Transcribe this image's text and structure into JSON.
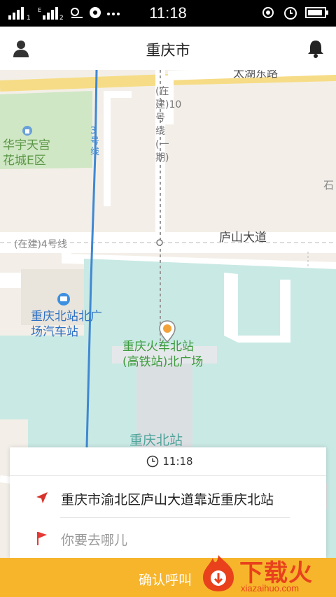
{
  "status_bar": {
    "time": "11:18"
  },
  "header": {
    "title": "重庆市"
  },
  "map": {
    "labels": {
      "road_taihu": "太湖东路",
      "line3": "3号线",
      "line10": "(在建)10号线(一期)",
      "huayu": "华宇天宫花城E区",
      "lushan": "庐山大道",
      "line4": "(在建)4号线",
      "bus_station": "重庆北站北广场汽车站",
      "train_station": "重庆火车北站(高铁站)北广场",
      "north_station": "重庆北站",
      "partial_right": "石"
    }
  },
  "card": {
    "time": "11:18",
    "from_address": "重庆市渝北区庐山大道靠近重庆北站",
    "to_placeholder": "你要去哪儿"
  },
  "bottom": {
    "confirm_label": "确认呼叫"
  },
  "watermark": {
    "brand": "下载火",
    "domain": "xiazaihuo.com"
  },
  "colors": {
    "accent": "#f7b52c",
    "flag": "#e53935",
    "line": "#3f88d2",
    "watermark": "#e8411c"
  },
  "icons": [
    "person-icon",
    "bell-icon",
    "locate-icon",
    "clock-icon",
    "arrow-icon",
    "flag-icon",
    "bus-icon",
    "poi-pin-icon"
  ]
}
